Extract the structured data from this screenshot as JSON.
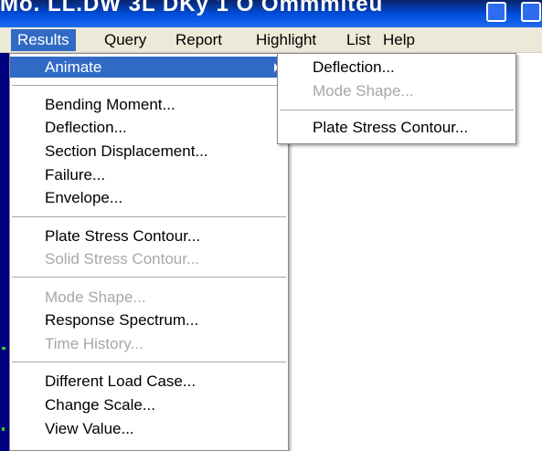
{
  "window": {
    "title": "Mo. LL.DW 3L DKy 1 O Ommmiteu"
  },
  "menubar": {
    "items": [
      "Results",
      "Query",
      "Report",
      "Highlight",
      "List",
      "Help"
    ]
  },
  "results_menu": {
    "animate": "Animate",
    "group1": [
      "Bending Moment...",
      "Deflection...",
      "Section Displacement...",
      "Failure...",
      "Envelope..."
    ],
    "group2": [
      "Plate Stress Contour...",
      "Solid Stress Contour..."
    ],
    "group3": [
      "Mode Shape...",
      "Response Spectrum...",
      "Time History..."
    ],
    "group4": [
      "Different Load Case...",
      "Change Scale...",
      "View Value..."
    ]
  },
  "animate_submenu": {
    "items": [
      "Deflection...",
      "Mode Shape...",
      "Plate Stress Contour..."
    ]
  },
  "colors": {
    "highlight": "#316ac5",
    "menubar": "#ece9d8",
    "disabled_text": "#a7a6aa",
    "titlebar": "#0050e0"
  }
}
